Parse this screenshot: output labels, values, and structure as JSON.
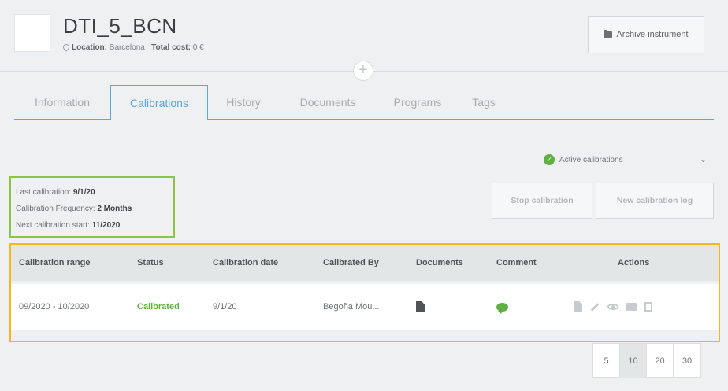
{
  "instrument": {
    "title": "DTI_5_BCN",
    "location_label": "Location:",
    "location_value": "Barcelona",
    "cost_label": "Total cost:",
    "cost_value": "0 €",
    "archive_button": "Archive instrument",
    "add_symbol": "+"
  },
  "tabs": [
    {
      "label": "Information",
      "active": false
    },
    {
      "label": "Calibrations",
      "active": true
    },
    {
      "label": "History",
      "active": false
    },
    {
      "label": "Documents",
      "active": false
    },
    {
      "label": "Programs",
      "active": false
    },
    {
      "label": "Tags",
      "active": false
    }
  ],
  "filter": {
    "label": "Active calibrations",
    "chevron": "⌄"
  },
  "summary": {
    "last_label": "Last calibration:",
    "last_value": "9/1/20",
    "freq_label": "Calibration Frequency:",
    "freq_value": "2 Months",
    "next_label": "Next calibration start:",
    "next_value": "11/2020"
  },
  "actions": {
    "stop": "Stop calibration",
    "new_log": "New calibration log"
  },
  "table": {
    "columns": [
      "Calibration range",
      "Status",
      "Calibration date",
      "Calibrated By",
      "Documents",
      "Comment",
      "Actions"
    ],
    "rows": [
      {
        "range": "09/2020 - 10/2020",
        "status": "Calibrated",
        "date": "9/1/20",
        "by": "Begoña Mou..."
      }
    ]
  },
  "pagination": {
    "sizes": [
      "5",
      "10",
      "20",
      "30"
    ],
    "current": "10"
  },
  "colors": {
    "accent": "#5fa7d6",
    "success": "#5fb043",
    "highlight_green": "#8cc63f",
    "highlight_yellow": "#f4b81a"
  }
}
